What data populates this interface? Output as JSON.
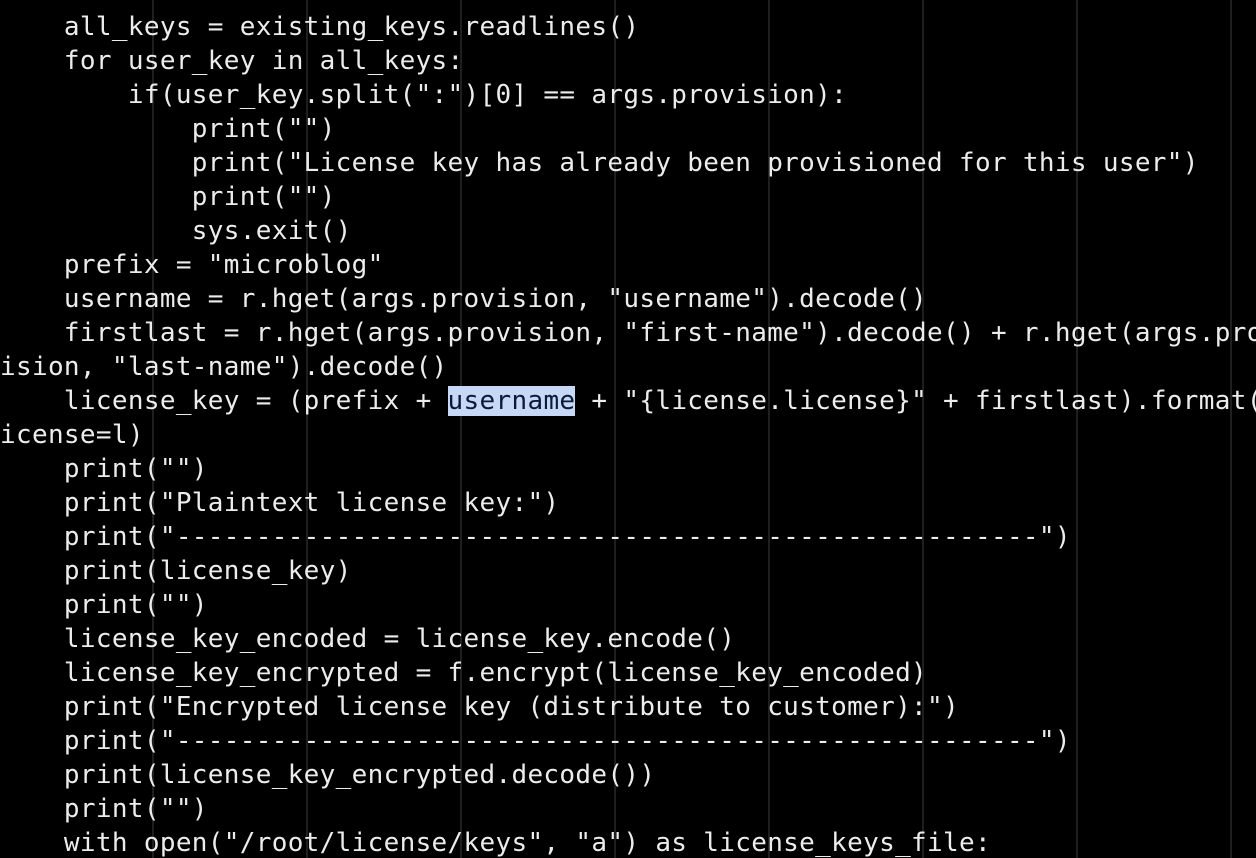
{
  "editor": {
    "lines": [
      "    all_keys = existing_keys.readlines()",
      "    for user_key in all_keys:",
      "        if(user_key.split(\":\")[0] == args.provision):",
      "            print(\"\")",
      "            print(\"License key has already been provisioned for this user\")",
      "            print(\"\")",
      "            sys.exit()",
      "    prefix = \"microblog\"",
      "    username = r.hget(args.provision, \"username\").decode()",
      "    firstlast = r.hget(args.provision, \"first-name\").decode() + r.hget(args.prov",
      "ision, \"last-name\").decode()",
      {
        "before": "    license_key = (prefix + ",
        "selected": "username",
        "after": " + \"{license.license}\" + firstlast).format(l"
      },
      "icense=l)",
      "    print(\"\")",
      "    print(\"Plaintext license key:\")",
      "    print(\"------------------------------------------------------\")",
      "    print(license_key)",
      "    print(\"\")",
      "    license_key_encoded = license_key.encode()",
      "    license_key_encrypted = f.encrypt(license_key_encoded)",
      "    print(\"Encrypted license key (distribute to customer):\")",
      "    print(\"------------------------------------------------------\")",
      "    print(license_key_encrypted.decode())",
      "    print(\"\")",
      "    with open(\"/root/license/keys\", \"a\") as license_keys_file:"
    ]
  },
  "colors": {
    "background": "#000000",
    "text": "#ececec",
    "selection_background": "#c6d8f5",
    "selection_text": "#0b1a3a"
  }
}
